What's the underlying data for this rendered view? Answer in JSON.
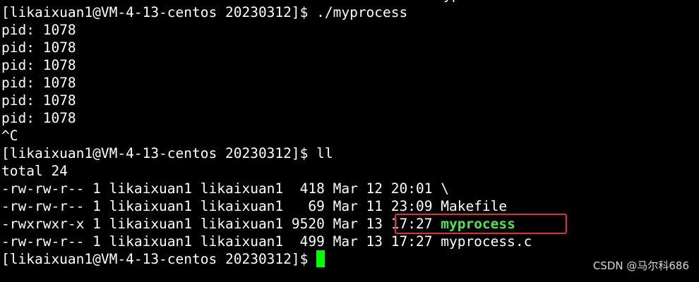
{
  "terminal": {
    "lines": [
      "[likaixuan1@VM-4-13-centos 20230312]$ ./myprocess",
      "pid: 1078",
      "pid: 1078",
      "pid: 1078",
      "pid: 1078",
      "pid: 1078",
      "pid: 1078",
      "^C",
      "[likaixuan1@VM-4-13-centos 20230312]$ ll",
      "total 24",
      "-rw-rw-r-- 1 likaixuan1 likaixuan1  418 Mar 12 20:01 \\",
      "-rw-rw-r-- 1 likaixuan1 likaixuan1   69 Mar 11 23:09 Makefile",
      "-rw-rw-r-- 1 likaixuan1 likaixuan1  499 Mar 13 17:27 myprocess.c"
    ],
    "exec_line_prefix": "-rwxrwxr-x 1 likaixuan1 likaixuan1 9520 Mar 13 17:27 ",
    "exec_file_name": "myprocess",
    "prompt": "[likaixuan1@VM-4-13-centos 20230312]$ ",
    "top_cut_text": "yp"
  },
  "watermark": "CSDN @马尔科686",
  "colors": {
    "background": "#000000",
    "text": "#ffffff",
    "executable": "#4ee44e",
    "cursor": "#00ff00",
    "highlight_box": "#e03030"
  }
}
